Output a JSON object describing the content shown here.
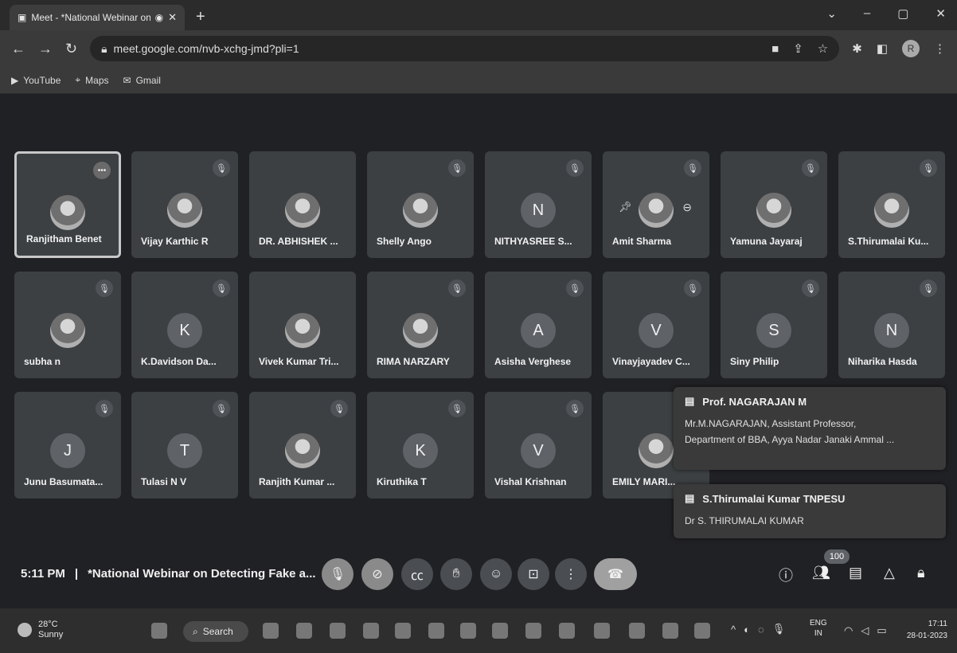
{
  "browser": {
    "tab_title": "Meet - *National Webinar on",
    "new_tab": "+",
    "url": "meet.google.com/nvb-xchg-jmd?pli=1",
    "profile_initial": "R",
    "bookmarks": [
      "YouTube",
      "Maps",
      "Gmail"
    ]
  },
  "participants": [
    {
      "name": "Ranjitham Benet",
      "avatar": "photo",
      "mic": "more"
    },
    {
      "name": "Vijay Karthic R",
      "avatar": "photo",
      "mic": "muted"
    },
    {
      "name": "DR. ABHISHEK ...",
      "avatar": "photo",
      "mic": "none"
    },
    {
      "name": "Shelly Ango",
      "avatar": "photo",
      "mic": "muted"
    },
    {
      "name": "NITHYASREE S...",
      "avatar": "N",
      "mic": "muted"
    },
    {
      "name": "Amit Sharma",
      "avatar": "photo",
      "mic": "muted"
    },
    {
      "name": "Yamuna Jayaraj",
      "avatar": "photo",
      "mic": "muted"
    },
    {
      "name": "S.Thirumalai Ku...",
      "avatar": "photo",
      "mic": "muted"
    },
    {
      "name": "subha n",
      "avatar": "photo",
      "mic": "muted"
    },
    {
      "name": "K.Davidson Da...",
      "avatar": "K",
      "mic": "muted"
    },
    {
      "name": "Vivek Kumar Tri...",
      "avatar": "photo",
      "mic": "none"
    },
    {
      "name": "RIMA NARZARY",
      "avatar": "photo",
      "mic": "muted"
    },
    {
      "name": "Asisha Verghese",
      "avatar": "A",
      "mic": "muted"
    },
    {
      "name": "Vinayjayadev C...",
      "avatar": "V",
      "mic": "muted"
    },
    {
      "name": "Siny Philip",
      "avatar": "S",
      "mic": "muted"
    },
    {
      "name": "Niharika Hasda",
      "avatar": "N",
      "mic": "muted"
    },
    {
      "name": "Junu Basumata...",
      "avatar": "J",
      "mic": "muted"
    },
    {
      "name": "Tulasi N V",
      "avatar": "T",
      "mic": "muted"
    },
    {
      "name": "Ranjith Kumar ...",
      "avatar": "photo",
      "mic": "muted"
    },
    {
      "name": "Kiruthika T",
      "avatar": "K",
      "mic": "muted"
    },
    {
      "name": "Vishal Krishnan",
      "avatar": "V",
      "mic": "muted"
    },
    {
      "name": "EMILY MARI...",
      "avatar": "photo",
      "mic": "none"
    }
  ],
  "chat_popups": [
    {
      "sender": "Prof. NAGARAJAN M",
      "line1": "Mr.M.NAGARAJAN, Assistant Professor,",
      "line2": "Department of BBA, Ayya Nadar Janaki Ammal ..."
    },
    {
      "sender": "S.Thirumalai Kumar TNPESU",
      "line1": "Dr S. THIRUMALAI KUMAR"
    }
  ],
  "meeting": {
    "time": "5:11 PM",
    "separator": "|",
    "title": "*National Webinar on Detecting Fake a...",
    "participant_count": "100"
  },
  "taskbar": {
    "temp": "28°C",
    "condition": "Sunny",
    "search": "Search",
    "lang": "ENG",
    "region": "IN",
    "time": "17:11",
    "date": "28-01-2023"
  }
}
